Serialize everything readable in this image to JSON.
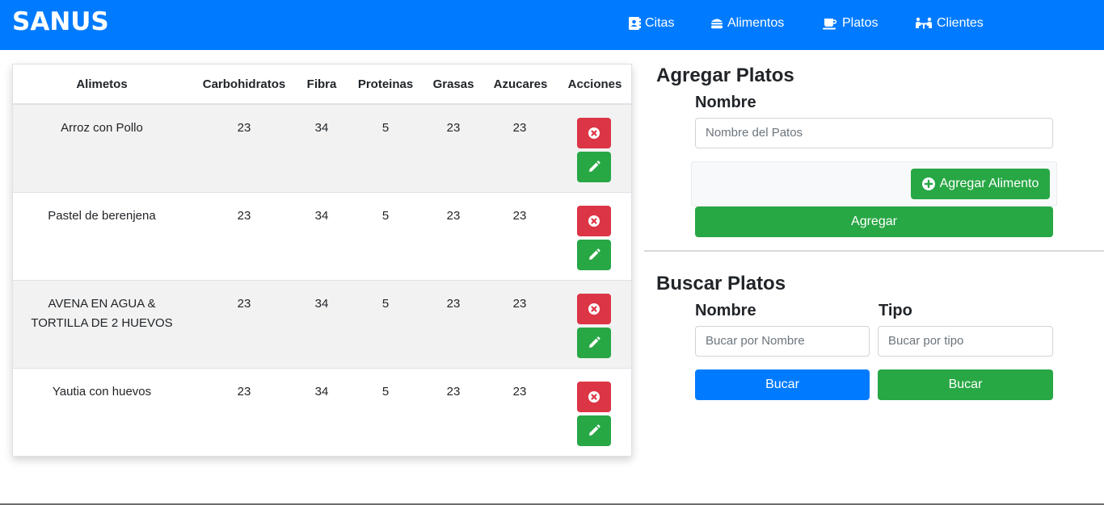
{
  "navbar": {
    "brand": "SANUS",
    "items": [
      {
        "label": "Citas",
        "icon": "address-book-icon"
      },
      {
        "label": "Alimentos",
        "icon": "hamburger-icon"
      },
      {
        "label": "Platos",
        "icon": "coffee-cup-icon"
      },
      {
        "label": "Clientes",
        "icon": "people-table-icon"
      }
    ]
  },
  "table": {
    "headers": [
      "Alimetos",
      "Carbohidratos",
      "Fibra",
      "Proteinas",
      "Grasas",
      "Azucares",
      "Acciones"
    ],
    "rows": [
      {
        "name_line1": "Arroz con Pollo",
        "name_line2": "",
        "carbohidratos": "23",
        "fibra": "34",
        "proteinas": "5",
        "grasas": "23",
        "azucares": "23"
      },
      {
        "name_line1": "Pastel de berenjena",
        "name_line2": "",
        "carbohidratos": "23",
        "fibra": "34",
        "proteinas": "5",
        "grasas": "23",
        "azucares": "23"
      },
      {
        "name_line1": "AVENA EN AGUA &",
        "name_line2": "TORTILLA DE 2 HUEVOS",
        "carbohidratos": "23",
        "fibra": "34",
        "proteinas": "5",
        "grasas": "23",
        "azucares": "23"
      },
      {
        "name_line1": "Yautia con huevos",
        "name_line2": "",
        "carbohidratos": "23",
        "fibra": "34",
        "proteinas": "5",
        "grasas": "23",
        "azucares": "23"
      }
    ]
  },
  "agregar": {
    "title": "Agregar Platos",
    "nombre_label": "Nombre",
    "nombre_placeholder": "Nombre del Patos",
    "agregar_alimento_label": "Agregar Alimento",
    "agregar_label": "Agregar"
  },
  "buscar": {
    "title": "Buscar Platos",
    "nombre_label": "Nombre",
    "tipo_label": "Tipo",
    "nombre_placeholder": "Bucar por Nombre",
    "tipo_placeholder": "Bucar por tipo",
    "buscar_nombre_label": "Bucar",
    "buscar_tipo_label": "Bucar"
  },
  "colors": {
    "primary": "#007bff",
    "success": "#28a745",
    "danger": "#dc3545",
    "stripe": "#f2f2f2"
  }
}
